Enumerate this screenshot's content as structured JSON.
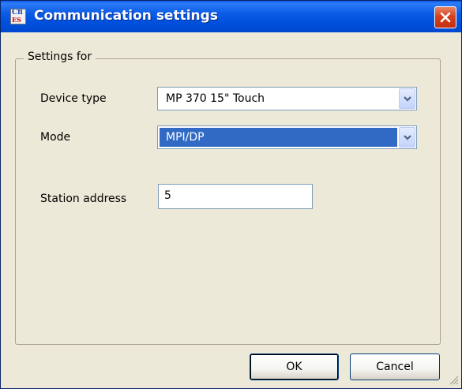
{
  "window": {
    "title": "Communication settings",
    "icon": "simatic-cfl-icon",
    "icon_text_top": "Cfl",
    "icon_text_bottom": "ES"
  },
  "group": {
    "label": "Settings for"
  },
  "fields": {
    "device_type": {
      "label": "Device type",
      "value": "MP 370 15\" Touch"
    },
    "mode": {
      "label": "Mode",
      "value": "MPI/DP"
    },
    "station_address": {
      "label": "Station address",
      "value": "5"
    }
  },
  "buttons": {
    "ok": "OK",
    "cancel": "Cancel"
  },
  "colors": {
    "titlebar": "#0054e3",
    "selection": "#316ac5",
    "dialog_bg": "#ece9d8"
  }
}
